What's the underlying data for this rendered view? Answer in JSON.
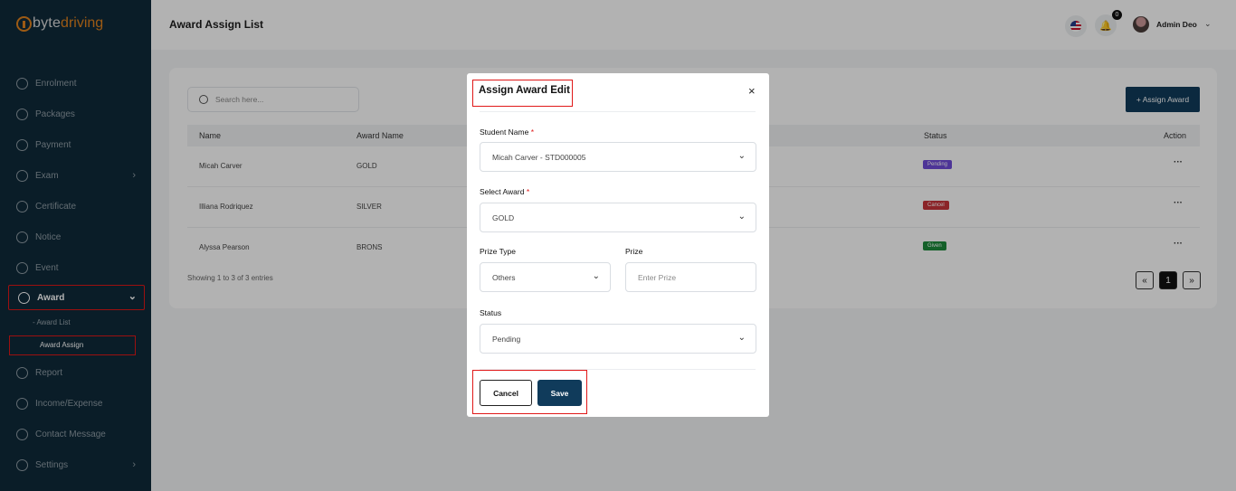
{
  "brand": {
    "part1": "byte",
    "part2": "driving"
  },
  "sidebar": {
    "items": [
      {
        "label": "Enrolment",
        "icon": "enrolment-icon"
      },
      {
        "label": "Packages",
        "icon": "packages-icon"
      },
      {
        "label": "Payment",
        "icon": "payment-icon"
      },
      {
        "label": "Exam",
        "icon": "exam-icon"
      },
      {
        "label": "Certificate",
        "icon": "certificate-icon"
      },
      {
        "label": "Notice",
        "icon": "notice-icon"
      },
      {
        "label": "Event",
        "icon": "event-icon"
      },
      {
        "label": "Award",
        "icon": "award-icon"
      },
      {
        "label": "Report",
        "icon": "report-icon"
      },
      {
        "label": "Income/Expense",
        "icon": "income-icon"
      },
      {
        "label": "Contact Message",
        "icon": "message-icon"
      },
      {
        "label": "Settings",
        "icon": "settings-icon"
      }
    ],
    "award_sub": [
      "Award List",
      "Award Assign"
    ]
  },
  "header": {
    "title": "Award Assign List",
    "notifications": "0",
    "user": "Admin Deo"
  },
  "list": {
    "search_placeholder": "Search here...",
    "add_button": "+ Assign Award",
    "columns": {
      "name": "Name",
      "award": "Award Name",
      "status": "Status",
      "action": "Action"
    },
    "rows": [
      {
        "name": "Micah Carver",
        "award": "GOLD",
        "status": "Pending",
        "status_color": "#6f4bd8"
      },
      {
        "name": "Illiana Rodriquez",
        "award": "SILVER",
        "status": "Cancel",
        "status_color": "#c8343a"
      },
      {
        "name": "Alyssa Pearson",
        "award": "BRONS",
        "status": "Given",
        "status_color": "#1e8a3c"
      }
    ],
    "showing": "Showing 1 to 3 of 3 entries",
    "pager": {
      "prev": "«",
      "page": "1",
      "next": "»"
    }
  },
  "modal": {
    "title": "Assign Award Edit",
    "close": "×",
    "student_label": "Student Name",
    "student_value": "Micah Carver - STD000005",
    "award_label": "Select Award",
    "award_value": "GOLD",
    "prize_type_label": "Prize Type",
    "prize_type_value": "Others",
    "prize_label": "Prize",
    "prize_placeholder": "Enter Prize",
    "status_label": "Status",
    "status_value": "Pending",
    "required_mark": "*",
    "cancel": "Cancel",
    "save": "Save"
  }
}
